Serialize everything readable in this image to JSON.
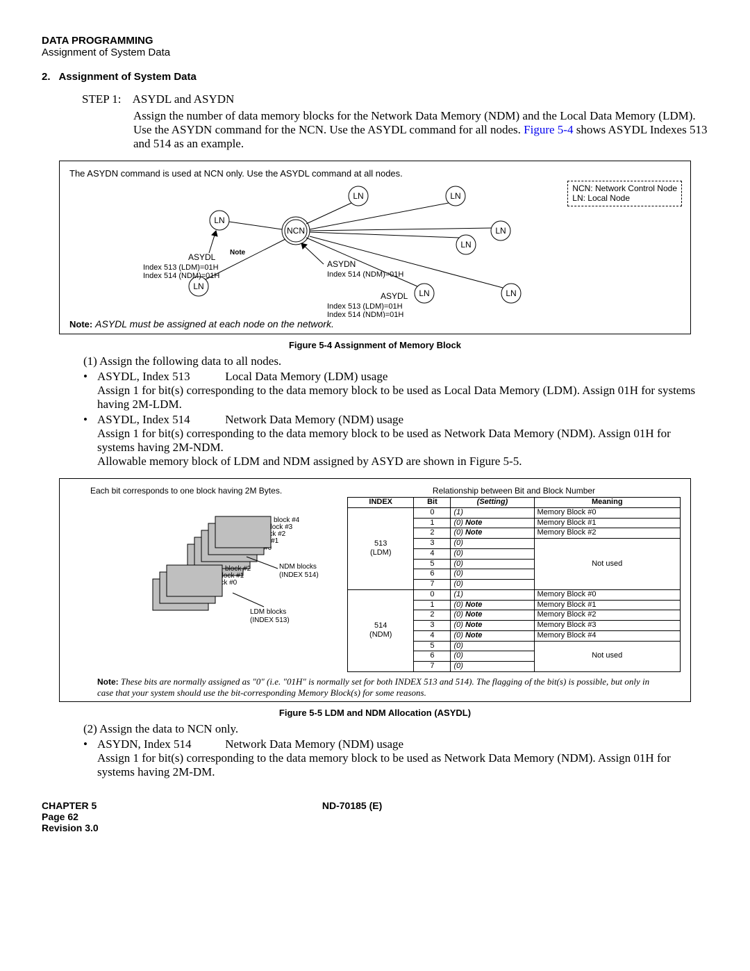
{
  "header": {
    "title": "DATA PROGRAMMING",
    "subtitle": "Assignment of System Data"
  },
  "section": {
    "number": "2.",
    "title": "Assignment of System Data"
  },
  "step1": {
    "label": "STEP 1:",
    "title": "ASYDL and ASYDN",
    "body_l1": "Assign the number of data memory blocks for the Network Data Memory (NDM) and the Local Data Memory (LDM). Use the ASYDN command for the NCN. Use the ASYDL command for all nodes.",
    "figref": "Figure 5-4",
    "body_l2": " shows ASYDL Indexes 513 and 514 as an example."
  },
  "figure4": {
    "top_note": "The ASYDN command is used at NCN only. Use the ASYDL command at all nodes.",
    "legend_l1": "NCN: Network Control Node",
    "legend_l2": "LN: Local Node",
    "asydl_label": "ASYDL",
    "asydn_label": "ASYDN",
    "asydl_idx1": "Index 513 (LDM)=01H",
    "asydl_idx2": "Index 514 (NDM)=01H",
    "asydn_idx": "Index 514 (NDM)=01H",
    "note_word": "Note",
    "bottom_note_label": "Note:",
    "bottom_note_text": "ASYDL must be assigned at each node on the network.",
    "caption": "Figure 5-4   Assignment of Memory Block"
  },
  "body1": {
    "item1": "(1)   Assign the following data to all nodes.",
    "b1_cmd": "ASYDL, Index 513",
    "b1_desc": "Local Data Memory (LDM) usage",
    "b1_l1": "Assign 1 for bit(s) corresponding to the data memory block to be used as Local Data Memory (LDM). Assign 01H for systems having 2M-LDM.",
    "b2_cmd": "ASYDL, Index 514",
    "b2_desc": "Network Data Memory (NDM) usage",
    "b2_l1": "Assign 1 for bit(s) corresponding to the data memory block to be used as Network Data Memory (NDM). Assign 01H for systems having 2M-NDM.",
    "b2_l2": "Allowable memory block of LDM and NDM assigned by ASYD are shown in Figure 5-5."
  },
  "figure5": {
    "left_caption": "Each bit corresponds to one block having 2M Bytes.",
    "right_caption": "Relationship between Bit and Block Number",
    "ndm_label": "NDM blocks\n(INDEX 514)",
    "ldm_label": "LDM blocks\n(INDEX 513)",
    "stack_ndm": [
      "block #4",
      "block #3",
      "block #2",
      "block #1",
      "block #0"
    ],
    "stack_ldm": [
      "block #2",
      "block #1",
      "block #0"
    ],
    "table": {
      "headers": [
        "INDEX",
        "Bit",
        "Setting",
        "Meaning"
      ],
      "setting_italic_col": "(Setting)",
      "rows513": [
        {
          "bit": "0",
          "setting": "(1)",
          "meaning": "Memory Block #0"
        },
        {
          "bit": "1",
          "setting": "(0) Note",
          "meaning": "Memory Block #1"
        },
        {
          "bit": "2",
          "setting": "(0) Note",
          "meaning": "Memory Block #2"
        },
        {
          "bit": "3",
          "setting": "(0)",
          "meaning_span_start": true,
          "meaning": "Not used"
        },
        {
          "bit": "4",
          "setting": "(0)"
        },
        {
          "bit": "5",
          "setting": "(0)"
        },
        {
          "bit": "6",
          "setting": "(0)"
        },
        {
          "bit": "7",
          "setting": "(0)"
        }
      ],
      "idx513": "513\n(LDM)",
      "rows514": [
        {
          "bit": "0",
          "setting": "(1)",
          "meaning": "Memory Block #0"
        },
        {
          "bit": "1",
          "setting": "(0) Note",
          "meaning": "Memory Block #1"
        },
        {
          "bit": "2",
          "setting": "(0) Note",
          "meaning": "Memory Block #2"
        },
        {
          "bit": "3",
          "setting": "(0) Note",
          "meaning": "Memory Block #3"
        },
        {
          "bit": "4",
          "setting": "(0) Note",
          "meaning": "Memory Block #4"
        },
        {
          "bit": "5",
          "setting": "(0)",
          "meaning_span_start": true,
          "meaning": "Not used"
        },
        {
          "bit": "6",
          "setting": "(0)"
        },
        {
          "bit": "7",
          "setting": "(0)"
        }
      ],
      "idx514": "514\n(NDM)"
    },
    "note_label": "Note:",
    "note_text": "These bits are normally assigned as \"0\" (i.e. \"01H\" is normally set for both INDEX 513 and 514). The flagging of the bit(s) is possible, but only in case that your system should use the bit-corresponding Memory Block(s) for some reasons.",
    "caption": "Figure 5-5   LDM and NDM Allocation (ASYDL)"
  },
  "body2": {
    "item2": "(2)   Assign the data to NCN only.",
    "b1_cmd": "ASYDN, Index 514",
    "b1_desc": "Network Data Memory (NDM) usage",
    "b1_l1": "Assign 1 for bit(s) corresponding to the data memory block to be used as Network Data Memory (NDM). Assign 01H for systems having 2M-DM."
  },
  "footer": {
    "chapter": "CHAPTER 5",
    "doc": "ND-70185 (E)",
    "page": "Page 62",
    "rev": "Revision 3.0"
  }
}
